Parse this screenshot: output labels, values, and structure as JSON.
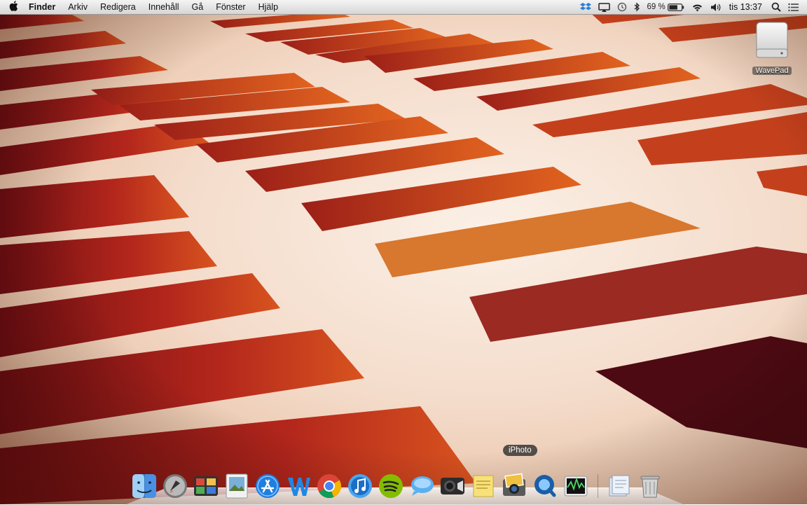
{
  "menubar": {
    "apple_icon": "apple-logo-icon",
    "app_name": "Finder",
    "items": [
      "Arkiv",
      "Redigera",
      "Innehåll",
      "Gå",
      "Fönster",
      "Hjälp"
    ],
    "battery": "69 %",
    "clock": "tis 13:37",
    "status_icons": [
      "dropbox-icon",
      "airplay-icon",
      "time-machine-icon",
      "bluetooth-icon",
      "battery-icon",
      "wifi-icon",
      "volume-icon",
      "spotlight-icon",
      "notification-center-icon"
    ]
  },
  "desktop": {
    "drive_label": "WavePad",
    "drive_icon": "external-drive-icon"
  },
  "dock": {
    "tooltip": "iPhoto",
    "items": [
      "finder-icon",
      "launchpad-icon",
      "photo-booth-icon",
      "preview-icon",
      "app-store-icon",
      "word-icon",
      "chrome-icon",
      "itunes-icon",
      "spotify-icon",
      "messages-icon",
      "facetime-icon",
      "stickies-icon",
      "iphoto-icon",
      "quicktime-icon",
      "activity-monitor-icon",
      "documents-stack-icon",
      "trash-icon"
    ]
  }
}
